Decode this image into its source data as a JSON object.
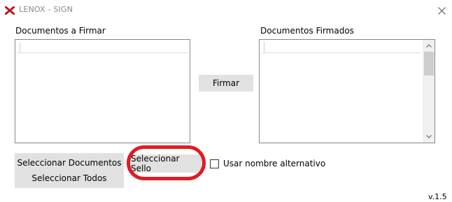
{
  "window": {
    "title": "LENOX - SIGN",
    "brand_color": "#c4161c",
    "close_icon": "close-icon"
  },
  "left_panel": {
    "label": "Documentos a Firmar",
    "items": []
  },
  "right_panel": {
    "label": "Documentos Firmados",
    "items": []
  },
  "buttons": {
    "sign": "Firmar",
    "select_documents": "Seleccionar Documentos",
    "select_all": "Seleccionar Todos",
    "select_seal": "Seleccionar Sello"
  },
  "options": {
    "alt_name_label": "Usar nombre alternativo",
    "alt_name_checked": false
  },
  "annotation": {
    "highlight_color": "#e01b24"
  },
  "footer": {
    "version": "v.1.5"
  }
}
